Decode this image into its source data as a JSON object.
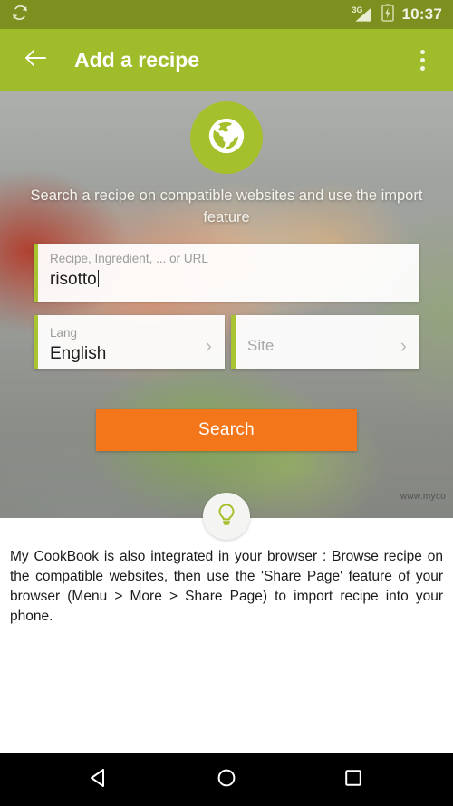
{
  "status_bar": {
    "sync_icon": "sync-icon",
    "network_label": "3G",
    "signal_icon": "signal-icon",
    "battery_icon": "battery-charging-icon",
    "time": "10:37"
  },
  "app_bar": {
    "back_icon": "back-arrow-icon",
    "title": "Add a recipe",
    "overflow_icon": "overflow-menu-icon"
  },
  "hero": {
    "badge_icon": "globe-icon",
    "caption": "Search a recipe on compatible websites and use the import feature",
    "watermark": "www.myco"
  },
  "form": {
    "search_input": {
      "label": "Recipe, Ingredient, ... or URL",
      "value": "risotto"
    },
    "lang_picker": {
      "label": "Lang",
      "value": "English",
      "chevron_icon": "chevron-right-icon"
    },
    "site_picker": {
      "placeholder": "Site",
      "chevron_icon": "chevron-right-icon"
    },
    "search_button": "Search"
  },
  "tip": {
    "bulb_icon": "lightbulb-icon",
    "text": "My CookBook is also integrated in your browser : Browse recipe on the compatible websites, then use the 'Share Page' feature of your browser (Menu > More > Share Page) to import recipe into your phone."
  },
  "nav_bar": {
    "back_icon": "nav-back-icon",
    "home_icon": "nav-home-icon",
    "recents_icon": "nav-recents-icon"
  },
  "colors": {
    "status_bar": "#7d901f",
    "app_bar": "#9fbd2b",
    "accent_green": "#a8c431",
    "search_button": "#f4761b"
  }
}
